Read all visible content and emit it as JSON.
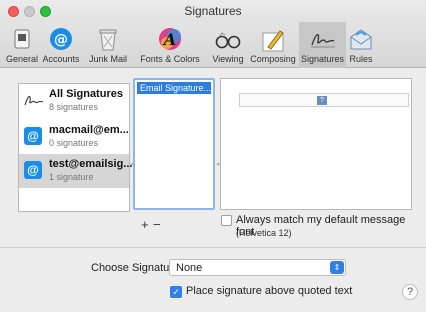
{
  "window": {
    "title": "Signatures"
  },
  "toolbar": {
    "items": [
      {
        "label": "General",
        "icon": "switch-icon"
      },
      {
        "label": "Accounts",
        "icon": "at-icon"
      },
      {
        "label": "Junk Mail",
        "icon": "trash-can-icon"
      },
      {
        "label": "Fonts & Colors",
        "icon": "fonts-colors-icon"
      },
      {
        "label": "Viewing",
        "icon": "glasses-icon"
      },
      {
        "label": "Composing",
        "icon": "pencil-icon"
      },
      {
        "label": "Signatures",
        "icon": "signature-icon",
        "selected": true
      },
      {
        "label": "Rules",
        "icon": "envelope-rules-icon"
      }
    ]
  },
  "accounts": [
    {
      "name": "All Signatures",
      "count": "8 signatures",
      "icon": "signature-icon"
    },
    {
      "name": "macmail@em...",
      "count": "0 signatures",
      "icon": "at-icon"
    },
    {
      "name": "test@emailsig...",
      "count": "1 signature",
      "icon": "at-icon",
      "selected": true
    }
  ],
  "signatures": [
    "Email Signature..."
  ],
  "list_controls": {
    "add": "+",
    "remove": "−"
  },
  "options": {
    "match_font_label": "Always match my default message font",
    "match_font_sub": "(Helvetica 12)",
    "match_font_checked": false,
    "choose_label": "Choose Signature:",
    "choose_value": "None",
    "place_label": "Place signature above quoted text",
    "place_checked": true
  },
  "colors": {
    "accent": "#2f7fe6",
    "selection": "#2d7de0"
  }
}
